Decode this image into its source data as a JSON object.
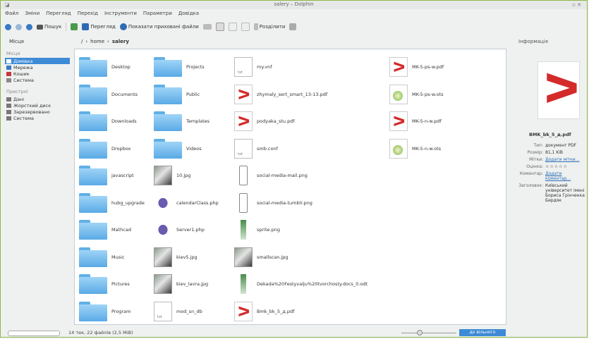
{
  "window": {
    "title": "salery – Dolphin",
    "controls": "▫ ✕"
  },
  "menu": [
    "Файл",
    "Зміни",
    "Перегляд",
    "Перехід",
    "Інструменти",
    "Параметри",
    "Довідка"
  ],
  "toolbar": {
    "search": "Пошук",
    "preview": "Перегляд",
    "show_hidden": "Показати приховані файли",
    "split": "Розділити"
  },
  "places_header": "Місця",
  "info_header": "Інформація",
  "breadcrumb": [
    "home",
    "salery"
  ],
  "sidebar": {
    "places_label": "Місця",
    "places": [
      "Домівка",
      "Мережа",
      "Кошик",
      "Система"
    ],
    "devices_label": "Пристрої",
    "devices": [
      "Дані",
      "Жорсткий диск",
      "Зарезервовано",
      "Система"
    ]
  },
  "files": [
    {
      "name": "Desktop",
      "type": "folder"
    },
    {
      "name": "Projects",
      "type": "folder"
    },
    {
      "name": "my.vnf",
      "type": "doc"
    },
    {
      "name": "MK-5-ps-w.pdf",
      "type": "pdf"
    },
    {
      "name": "Documents",
      "type": "folder"
    },
    {
      "name": "Public",
      "type": "folder"
    },
    {
      "name": "zhymaly_sert_smart_13-13.pdf",
      "type": "pdf"
    },
    {
      "name": "MK-5-ps-w.ots",
      "type": "ods"
    },
    {
      "name": "Downloads",
      "type": "folder"
    },
    {
      "name": "Templates",
      "type": "folder"
    },
    {
      "name": "podyaka_stu.pdf",
      "type": "pdf"
    },
    {
      "name": "MK-5-n-w.pdf",
      "type": "pdf"
    },
    {
      "name": "Dropbox",
      "type": "folder"
    },
    {
      "name": "Videos",
      "type": "folder"
    },
    {
      "name": "smb.conf",
      "type": "doc"
    },
    {
      "name": "MK-5-n-w.ots",
      "type": "ods"
    },
    {
      "name": "javascript",
      "type": "folder"
    },
    {
      "name": "10.jpg",
      "type": "img"
    },
    {
      "name": "social-media-mail.png",
      "type": "phone"
    },
    {
      "name": "",
      "type": "empty"
    },
    {
      "name": "hubg_upgrade",
      "type": "folder"
    },
    {
      "name": "calendarClass.php",
      "type": "php"
    },
    {
      "name": "social-media-tumblr.png",
      "type": "phone"
    },
    {
      "name": "",
      "type": "empty"
    },
    {
      "name": "Mathcad",
      "type": "folder"
    },
    {
      "name": "Server1.php",
      "type": "php"
    },
    {
      "name": "sprite.png",
      "type": "sprite"
    },
    {
      "name": "",
      "type": "empty"
    },
    {
      "name": "Music",
      "type": "folder"
    },
    {
      "name": "kiev5.jpg",
      "type": "img"
    },
    {
      "name": "smallscan.jpg",
      "type": "img"
    },
    {
      "name": "",
      "type": "empty"
    },
    {
      "name": "Pictures",
      "type": "folder"
    },
    {
      "name": "kiev_lavra.jpg",
      "type": "img"
    },
    {
      "name": "Dekada%20Festyvalju%20tvorchosty.docs_0.odt",
      "type": "sprite"
    },
    {
      "name": "",
      "type": "empty"
    },
    {
      "name": "Program",
      "type": "folder"
    },
    {
      "name": "mod_sn_db",
      "type": "doc"
    },
    {
      "name": "Bmk_bk_5_д.pdf",
      "type": "pdf"
    },
    {
      "name": "",
      "type": "empty"
    }
  ],
  "info": {
    "name": "BMK_bk_5_д.pdf",
    "fields": [
      {
        "k": "Тип:",
        "v": "документ PDF",
        "link": false
      },
      {
        "k": "Розмір:",
        "v": "81,1 KiB",
        "link": false
      },
      {
        "k": "Мітки:",
        "v": "Додати мітки...",
        "link": true
      },
      {
        "k": "Оцінка:",
        "v": "☆☆☆☆☆",
        "link": false
      },
      {
        "k": "Коментар:",
        "v": "Додати коментар...",
        "link": true
      },
      {
        "k": "Заголовок:",
        "v": "Київський університет імені Бориса Грінченка Бердяк",
        "link": false
      }
    ]
  },
  "status": {
    "text": "14 тек, 22 файлів (2,5 МіВ)",
    "free": "до вільного"
  }
}
